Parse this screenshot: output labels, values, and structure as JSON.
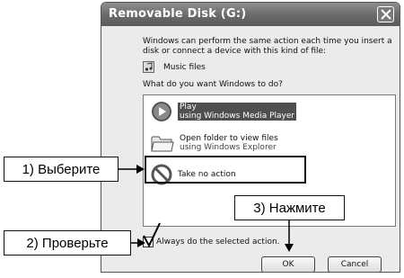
{
  "window": {
    "title": "Removable Disk (G:)"
  },
  "dialog": {
    "intro": "Windows can perform the same action each time you insert a disk or connect a device with this kind of file:",
    "content_type": "Music files",
    "question": "What do you want Windows to do?",
    "options": [
      {
        "title": "Play",
        "subtitle": "using Windows Media Player",
        "selected": true
      },
      {
        "title": "Open folder to view files",
        "subtitle": "using Windows Explorer",
        "selected": false
      },
      {
        "title": "Take no action",
        "subtitle": "",
        "selected": false
      }
    ],
    "always_label": "Always do the selected action.",
    "always_checked": true,
    "ok_label": "OK",
    "cancel_label": "Cancel"
  },
  "annotations": {
    "step1": "1) Выберите",
    "step2": "2) Проверьте",
    "step3": "3) Нажмите"
  }
}
